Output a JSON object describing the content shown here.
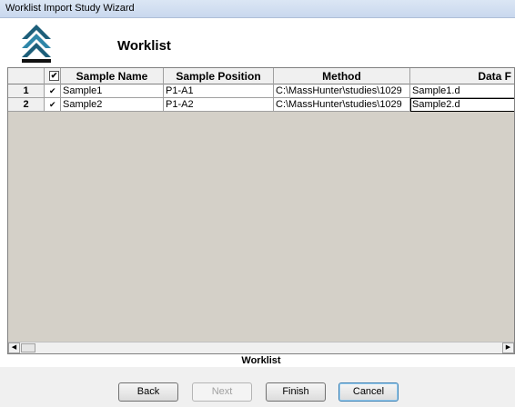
{
  "window": {
    "title": "Worklist Import Study Wizard"
  },
  "header": {
    "title": "Worklist"
  },
  "grid": {
    "columns": [
      {
        "key": "row",
        "label": ""
      },
      {
        "key": "check",
        "label": ""
      },
      {
        "key": "sample_name",
        "label": "Sample Name"
      },
      {
        "key": "sample_position",
        "label": "Sample Position"
      },
      {
        "key": "method",
        "label": "Method"
      },
      {
        "key": "data_file",
        "label": "Data F"
      }
    ],
    "header_check_glyph": "✔",
    "rows": [
      {
        "num": "1",
        "check": "✔",
        "sample_name": "Sample1",
        "sample_position": "P1-A1",
        "method": "C:\\MassHunter\\studies\\1029",
        "data_file": "Sample1.d"
      },
      {
        "num": "2",
        "check": "✔",
        "sample_name": "Sample2",
        "sample_position": "P1-A2",
        "method": "C:\\MassHunter\\studies\\1029",
        "data_file": "Sample2.d"
      }
    ],
    "caption": "Worklist"
  },
  "buttons": {
    "back": "Back",
    "next": "Next",
    "finish": "Finish",
    "cancel": "Cancel"
  },
  "icons": {
    "logo": "double-chevron-up-icon",
    "scroll_left": "arrow-left-icon",
    "scroll_right": "arrow-right-icon"
  }
}
